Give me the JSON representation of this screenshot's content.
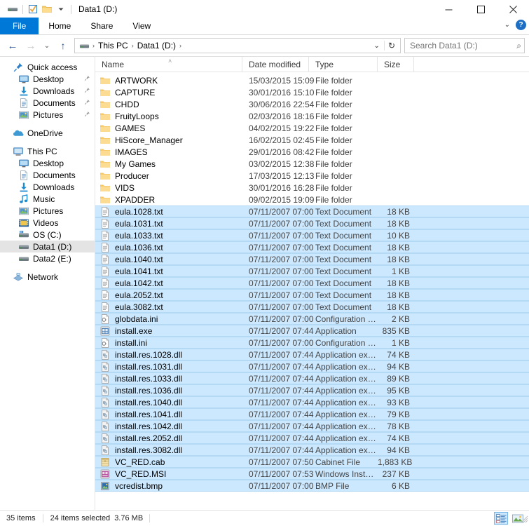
{
  "window": {
    "title": "Data1 (D:)",
    "quick_access_toolbar": [
      {
        "name": "drive-icon",
        "label": "Drive"
      },
      {
        "name": "properties-icon",
        "label": "Properties"
      },
      {
        "name": "new-folder-icon",
        "label": "New folder"
      },
      {
        "name": "customize-qat-icon",
        "label": "Customize Quick Access Toolbar"
      }
    ],
    "caption": {
      "minimize": "–",
      "maximize": "☐",
      "close": "✕"
    }
  },
  "ribbon": {
    "tabs": [
      {
        "label": "File",
        "active": true
      },
      {
        "label": "Home",
        "active": false
      },
      {
        "label": "Share",
        "active": false
      },
      {
        "label": "View",
        "active": false
      }
    ],
    "expand_label": "⌄",
    "help_label": "?"
  },
  "address": {
    "back_label": "←",
    "forward_label": "→",
    "recent_label": "⌄",
    "up_label": "↑",
    "crumbs": [
      "This PC",
      "Data1 (D:)"
    ],
    "crumb_separator": "›",
    "dropdown_label": "⌄",
    "refresh_label": "↻",
    "search_placeholder": "Search Data1 (D:)",
    "search_value": "",
    "search_icon": "⌕"
  },
  "navpane": {
    "groups": [
      {
        "name": "quick-access",
        "items": [
          {
            "label": "Quick access",
            "icon": "pin-icon",
            "indent": 0,
            "pinned": false,
            "selected": false
          },
          {
            "label": "Desktop",
            "icon": "desktop-icon",
            "indent": 1,
            "pinned": true,
            "selected": false
          },
          {
            "label": "Downloads",
            "icon": "downloads-icon",
            "indent": 1,
            "pinned": true,
            "selected": false
          },
          {
            "label": "Documents",
            "icon": "documents-icon",
            "indent": 1,
            "pinned": true,
            "selected": false
          },
          {
            "label": "Pictures",
            "icon": "pictures-icon",
            "indent": 1,
            "pinned": true,
            "selected": false
          }
        ]
      },
      {
        "name": "onedrive",
        "items": [
          {
            "label": "OneDrive",
            "icon": "onedrive-icon",
            "indent": 0,
            "pinned": false,
            "selected": false
          }
        ]
      },
      {
        "name": "this-pc",
        "items": [
          {
            "label": "This PC",
            "icon": "thispc-icon",
            "indent": 0,
            "pinned": false,
            "selected": false
          },
          {
            "label": "Desktop",
            "icon": "desktop-icon",
            "indent": 1,
            "pinned": false,
            "selected": false
          },
          {
            "label": "Documents",
            "icon": "documents-icon",
            "indent": 1,
            "pinned": false,
            "selected": false
          },
          {
            "label": "Downloads",
            "icon": "downloads-icon",
            "indent": 1,
            "pinned": false,
            "selected": false
          },
          {
            "label": "Music",
            "icon": "music-icon",
            "indent": 1,
            "pinned": false,
            "selected": false
          },
          {
            "label": "Pictures",
            "icon": "pictures-icon",
            "indent": 1,
            "pinned": false,
            "selected": false
          },
          {
            "label": "Videos",
            "icon": "videos-icon",
            "indent": 1,
            "pinned": false,
            "selected": false
          },
          {
            "label": "OS (C:)",
            "icon": "os-drive-icon",
            "indent": 1,
            "pinned": false,
            "selected": false
          },
          {
            "label": "Data1 (D:)",
            "icon": "drive-icon",
            "indent": 1,
            "pinned": false,
            "selected": true
          },
          {
            "label": "Data2 (E:)",
            "icon": "drive-icon",
            "indent": 1,
            "pinned": false,
            "selected": false
          }
        ]
      },
      {
        "name": "network",
        "items": [
          {
            "label": "Network",
            "icon": "network-icon",
            "indent": 0,
            "pinned": false,
            "selected": false
          }
        ]
      }
    ]
  },
  "filelist": {
    "columns": [
      {
        "key": "name",
        "label": "Name",
        "sorted": true,
        "sort_dir": "asc"
      },
      {
        "key": "date",
        "label": "Date modified",
        "sorted": false
      },
      {
        "key": "type",
        "label": "Type",
        "sorted": false
      },
      {
        "key": "size",
        "label": "Size",
        "sorted": false
      }
    ],
    "sort_caret": "˄",
    "rows": [
      {
        "name": "ARTWORK",
        "date": "15/03/2015 15:09",
        "type": "File folder",
        "size": "",
        "icon": "folder-icon",
        "selected": false
      },
      {
        "name": "CAPTURE",
        "date": "30/01/2016 15:10",
        "type": "File folder",
        "size": "",
        "icon": "folder-icon",
        "selected": false
      },
      {
        "name": "CHDD",
        "date": "30/06/2016 22:54",
        "type": "File folder",
        "size": "",
        "icon": "folder-icon",
        "selected": false
      },
      {
        "name": "FruityLoops",
        "date": "02/03/2016 18:16",
        "type": "File folder",
        "size": "",
        "icon": "folder-icon",
        "selected": false
      },
      {
        "name": "GAMES",
        "date": "04/02/2015 19:22",
        "type": "File folder",
        "size": "",
        "icon": "folder-icon",
        "selected": false
      },
      {
        "name": "HiScore_Manager",
        "date": "16/02/2015 02:45",
        "type": "File folder",
        "size": "",
        "icon": "folder-icon",
        "selected": false
      },
      {
        "name": "IMAGES",
        "date": "29/01/2016 08:42",
        "type": "File folder",
        "size": "",
        "icon": "folder-icon",
        "selected": false
      },
      {
        "name": "My Games",
        "date": "03/02/2015 12:38",
        "type": "File folder",
        "size": "",
        "icon": "folder-icon",
        "selected": false
      },
      {
        "name": "Producer",
        "date": "17/03/2015 12:13",
        "type": "File folder",
        "size": "",
        "icon": "folder-icon",
        "selected": false
      },
      {
        "name": "VIDS",
        "date": "30/01/2016 16:28",
        "type": "File folder",
        "size": "",
        "icon": "folder-icon",
        "selected": false
      },
      {
        "name": "XPADDER",
        "date": "09/02/2015 19:09",
        "type": "File folder",
        "size": "",
        "icon": "folder-icon",
        "selected": false
      },
      {
        "name": "eula.1028.txt",
        "date": "07/11/2007 07:00",
        "type": "Text Document",
        "size": "18 KB",
        "icon": "text-file-icon",
        "selected": true
      },
      {
        "name": "eula.1031.txt",
        "date": "07/11/2007 07:00",
        "type": "Text Document",
        "size": "18 KB",
        "icon": "text-file-icon",
        "selected": true
      },
      {
        "name": "eula.1033.txt",
        "date": "07/11/2007 07:00",
        "type": "Text Document",
        "size": "10 KB",
        "icon": "text-file-icon",
        "selected": true
      },
      {
        "name": "eula.1036.txt",
        "date": "07/11/2007 07:00",
        "type": "Text Document",
        "size": "18 KB",
        "icon": "text-file-icon",
        "selected": true
      },
      {
        "name": "eula.1040.txt",
        "date": "07/11/2007 07:00",
        "type": "Text Document",
        "size": "18 KB",
        "icon": "text-file-icon",
        "selected": true
      },
      {
        "name": "eula.1041.txt",
        "date": "07/11/2007 07:00",
        "type": "Text Document",
        "size": "1 KB",
        "icon": "text-file-icon",
        "selected": true
      },
      {
        "name": "eula.1042.txt",
        "date": "07/11/2007 07:00",
        "type": "Text Document",
        "size": "18 KB",
        "icon": "text-file-icon",
        "selected": true
      },
      {
        "name": "eula.2052.txt",
        "date": "07/11/2007 07:00",
        "type": "Text Document",
        "size": "18 KB",
        "icon": "text-file-icon",
        "selected": true
      },
      {
        "name": "eula.3082.txt",
        "date": "07/11/2007 07:00",
        "type": "Text Document",
        "size": "18 KB",
        "icon": "text-file-icon",
        "selected": true
      },
      {
        "name": "globdata.ini",
        "date": "07/11/2007 07:00",
        "type": "Configuration sett...",
        "size": "2 KB",
        "icon": "ini-file-icon",
        "selected": true
      },
      {
        "name": "install.exe",
        "date": "07/11/2007 07:44",
        "type": "Application",
        "size": "835 KB",
        "icon": "exe-file-icon",
        "selected": true
      },
      {
        "name": "install.ini",
        "date": "07/11/2007 07:00",
        "type": "Configuration sett...",
        "size": "1 KB",
        "icon": "ini-file-icon",
        "selected": true
      },
      {
        "name": "install.res.1028.dll",
        "date": "07/11/2007 07:44",
        "type": "Application extens...",
        "size": "74 KB",
        "icon": "dll-file-icon",
        "selected": true
      },
      {
        "name": "install.res.1031.dll",
        "date": "07/11/2007 07:44",
        "type": "Application extens...",
        "size": "94 KB",
        "icon": "dll-file-icon",
        "selected": true
      },
      {
        "name": "install.res.1033.dll",
        "date": "07/11/2007 07:44",
        "type": "Application extens...",
        "size": "89 KB",
        "icon": "dll-file-icon",
        "selected": true
      },
      {
        "name": "install.res.1036.dll",
        "date": "07/11/2007 07:44",
        "type": "Application extens...",
        "size": "95 KB",
        "icon": "dll-file-icon",
        "selected": true
      },
      {
        "name": "install.res.1040.dll",
        "date": "07/11/2007 07:44",
        "type": "Application extens...",
        "size": "93 KB",
        "icon": "dll-file-icon",
        "selected": true
      },
      {
        "name": "install.res.1041.dll",
        "date": "07/11/2007 07:44",
        "type": "Application extens...",
        "size": "79 KB",
        "icon": "dll-file-icon",
        "selected": true
      },
      {
        "name": "install.res.1042.dll",
        "date": "07/11/2007 07:44",
        "type": "Application extens...",
        "size": "78 KB",
        "icon": "dll-file-icon",
        "selected": true
      },
      {
        "name": "install.res.2052.dll",
        "date": "07/11/2007 07:44",
        "type": "Application extens...",
        "size": "74 KB",
        "icon": "dll-file-icon",
        "selected": true
      },
      {
        "name": "install.res.3082.dll",
        "date": "07/11/2007 07:44",
        "type": "Application extens...",
        "size": "94 KB",
        "icon": "dll-file-icon",
        "selected": true
      },
      {
        "name": "VC_RED.cab",
        "date": "07/11/2007 07:50",
        "type": "Cabinet File",
        "size": "1,883 KB",
        "icon": "cab-file-icon",
        "selected": true
      },
      {
        "name": "VC_RED.MSI",
        "date": "07/11/2007 07:53",
        "type": "Windows Installer ...",
        "size": "237 KB",
        "icon": "msi-file-icon",
        "selected": true
      },
      {
        "name": "vcredist.bmp",
        "date": "07/11/2007 07:00",
        "type": "BMP File",
        "size": "6 KB",
        "icon": "bmp-file-icon",
        "selected": true
      }
    ]
  },
  "statusbar": {
    "item_count": "35 items",
    "selection_info": "24 items selected",
    "selection_size": "3.76 MB",
    "views": [
      {
        "name": "details-view-button",
        "active": true
      },
      {
        "name": "large-icons-view-button",
        "active": false
      }
    ]
  },
  "colors": {
    "accent": "#0078d7",
    "selection": "#cce8ff",
    "folder": "#ffd98a"
  }
}
